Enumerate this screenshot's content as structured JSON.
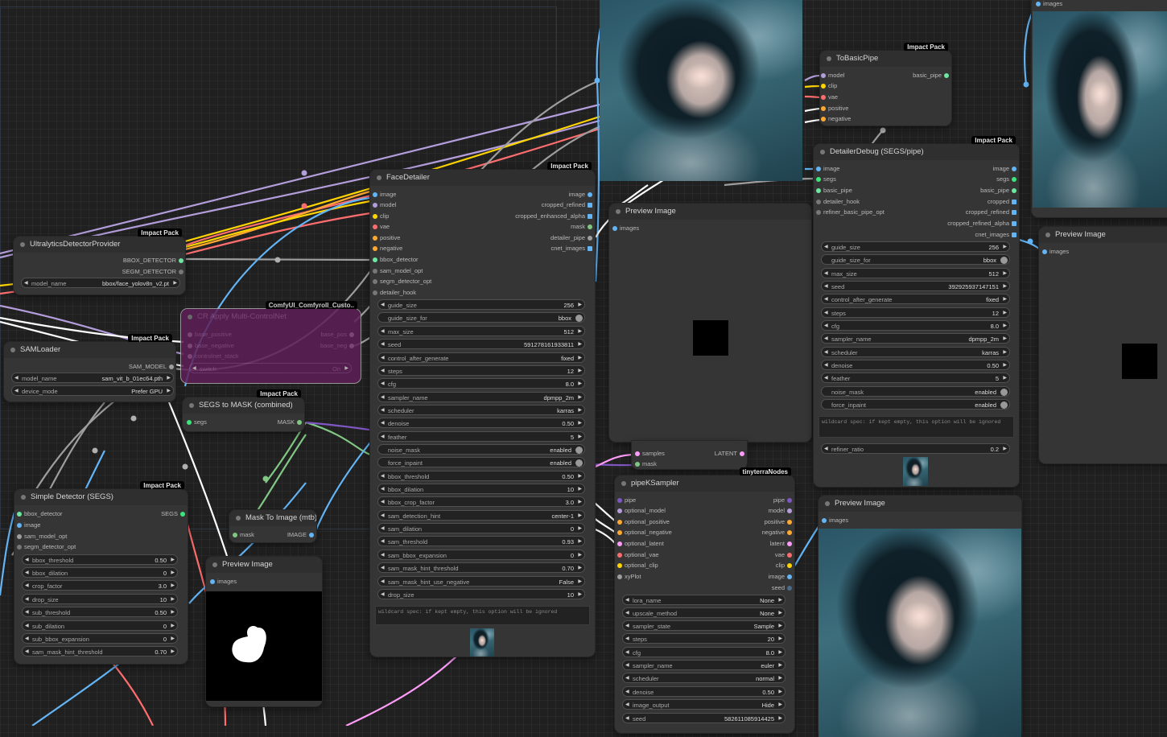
{
  "colors": {
    "canvas": "#202020",
    "node": "#353535",
    "model": "#b39ddb",
    "clip": "#ffd500",
    "vae": "#ff6e6e",
    "conditioning": "#ffa931",
    "image": "#64b5f6",
    "latent": "#ff9cf9",
    "pipe": "#7e57c2",
    "segs": "#3ce67b",
    "mask": "#81c784",
    "bbox": "#6ee7a0"
  },
  "ultralytics": {
    "badge": "Impact Pack",
    "title": "UltralyticsDetectorProvider",
    "out1": "BBOX_DETECTOR",
    "out2": "SEGM_DETECTOR",
    "w_label": "model_name",
    "w_value": "bbox/face_yolov8n_v2.pt"
  },
  "samloader": {
    "badge": "Impact Pack",
    "title": "SAMLoader",
    "out1": "SAM_MODEL",
    "w1_label": "model_name",
    "w1_value": "sam_vit_b_01ec64.pth",
    "w2_label": "device_mode",
    "w2_value": "Prefer GPU"
  },
  "cr_apply": {
    "badge": "ComfyUI_Comfyroll_Custo..",
    "title": "CR Apply Multi-ControlNet",
    "in1": "base_positive",
    "in2": "base_negative",
    "in3": "controlnet_stack",
    "out1": "base_pos",
    "out2": "base_neg",
    "w_label": "switch",
    "w_value": "On"
  },
  "segs_to_mask": {
    "badge": "Impact Pack",
    "title": "SEGS to MASK (combined)",
    "in1": "segs",
    "out1": "MASK"
  },
  "simple_detector": {
    "badge": "Impact Pack",
    "title": "Simple Detector (SEGS)",
    "in1": "bbox_detector",
    "in2": "image",
    "in3": "sam_model_opt",
    "in4": "segm_detector_opt",
    "out1": "SEGS",
    "widgets": [
      {
        "l": "bbox_threshold",
        "v": "0.50"
      },
      {
        "l": "bbox_dilation",
        "v": "0"
      },
      {
        "l": "crop_factor",
        "v": "3.0"
      },
      {
        "l": "drop_size",
        "v": "10"
      },
      {
        "l": "sub_threshold",
        "v": "0.50"
      },
      {
        "l": "sub_dilation",
        "v": "0"
      },
      {
        "l": "sub_bbox_expansion",
        "v": "0"
      },
      {
        "l": "sam_mask_hint_threshold",
        "v": "0.70"
      }
    ]
  },
  "mask_to_image": {
    "title": "Mask To Image (mtb)",
    "in1": "mask",
    "out1": "IMAGE"
  },
  "preview_mask": {
    "title": "Preview Image",
    "in1": "images"
  },
  "facedetailer": {
    "badge": "Impact Pack",
    "title": "FaceDetailer",
    "inputs": [
      "image",
      "model",
      "clip",
      "vae",
      "positive",
      "negative",
      "bbox_detector",
      "sam_model_opt",
      "segm_detector_opt",
      "detailer_hook"
    ],
    "outputs": [
      "image",
      "cropped_refined",
      "cropped_enhanced_alpha",
      "mask",
      "detailer_pipe",
      "cnet_images"
    ],
    "widgets": [
      {
        "l": "guide_size",
        "v": "256"
      },
      {
        "l": "guide_size_for",
        "v": "bbox"
      },
      {
        "l": "max_size",
        "v": "512"
      },
      {
        "l": "seed",
        "v": "591278161933811"
      },
      {
        "l": "control_after_generate",
        "v": "fixed"
      },
      {
        "l": "steps",
        "v": "12"
      },
      {
        "l": "cfg",
        "v": "8.0"
      },
      {
        "l": "sampler_name",
        "v": "dpmpp_2m"
      },
      {
        "l": "scheduler",
        "v": "karras"
      },
      {
        "l": "denoise",
        "v": "0.50"
      },
      {
        "l": "feather",
        "v": "5"
      },
      {
        "l": "noise_mask",
        "v": "enabled"
      },
      {
        "l": "force_inpaint",
        "v": "enabled"
      },
      {
        "l": "bbox_threshold",
        "v": "0.50"
      },
      {
        "l": "bbox_dilation",
        "v": "10"
      },
      {
        "l": "bbox_crop_factor",
        "v": "3.0"
      },
      {
        "l": "sam_detection_hint",
        "v": "center-1"
      },
      {
        "l": "sam_dilation",
        "v": "0"
      },
      {
        "l": "sam_threshold",
        "v": "0.93"
      },
      {
        "l": "sam_bbox_expansion",
        "v": "0"
      },
      {
        "l": "sam_mask_hint_threshold",
        "v": "0.70"
      },
      {
        "l": "sam_mask_hint_use_negative",
        "v": "False"
      },
      {
        "l": "drop_size",
        "v": "10"
      }
    ],
    "wildcard": "wildcard spec: if kept empty, this option will be ignored"
  },
  "preview_center": {
    "title": "Preview Image",
    "in1": "images"
  },
  "samples_node": {
    "in1": "samples",
    "in2": "mask",
    "out1": "LATENT"
  },
  "pipeksampler": {
    "badge": "tinyterraNodes",
    "title": "pipeKSampler",
    "inputs": [
      "pipe",
      "optional_model",
      "optional_positive",
      "optional_negative",
      "optional_latent",
      "optional_vae",
      "optional_clip",
      "xyPlot"
    ],
    "outputs": [
      "pipe",
      "model",
      "positive",
      "negative",
      "latent",
      "vae",
      "clip",
      "image",
      "seed"
    ],
    "widgets": [
      {
        "l": "lora_name",
        "v": "None"
      },
      {
        "l": "upscale_method",
        "v": "None"
      },
      {
        "l": "sampler_state",
        "v": "Sample"
      },
      {
        "l": "steps",
        "v": "20"
      },
      {
        "l": "cfg",
        "v": "8.0"
      },
      {
        "l": "sampler_name",
        "v": "euler"
      },
      {
        "l": "scheduler",
        "v": "normal"
      },
      {
        "l": "denoise",
        "v": "0.50"
      },
      {
        "l": "image_output",
        "v": "Hide"
      },
      {
        "l": "seed",
        "v": "582611085914425"
      }
    ]
  },
  "tobasicpipe": {
    "badge": "Impact Pack",
    "title": "ToBasicPipe",
    "inputs": [
      "model",
      "clip",
      "vae",
      "positive",
      "negative"
    ],
    "out1": "basic_pipe"
  },
  "detailerdebug": {
    "badge": "Impact Pack",
    "title": "DetailerDebug (SEGS/pipe)",
    "inputs": [
      "image",
      "segs",
      "basic_pipe",
      "detailer_hook",
      "refiner_basic_pipe_opt"
    ],
    "outputs": [
      "image",
      "segs",
      "basic_pipe",
      "cropped",
      "cropped_refined",
      "cropped_refined_alpha",
      "cnet_images"
    ],
    "widgets": [
      {
        "l": "guide_size",
        "v": "256"
      },
      {
        "l": "guide_size_for",
        "v": "bbox"
      },
      {
        "l": "max_size",
        "v": "512"
      },
      {
        "l": "seed",
        "v": "392925937147151"
      },
      {
        "l": "control_after_generate",
        "v": "fixed"
      },
      {
        "l": "steps",
        "v": "12"
      },
      {
        "l": "cfg",
        "v": "8.0"
      },
      {
        "l": "sampler_name",
        "v": "dpmpp_2m"
      },
      {
        "l": "scheduler",
        "v": "karras"
      },
      {
        "l": "denoise",
        "v": "0.50"
      },
      {
        "l": "feather",
        "v": "5"
      },
      {
        "l": "noise_mask",
        "v": "enabled"
      },
      {
        "l": "force_inpaint",
        "v": "enabled"
      }
    ],
    "wildcard": "wildcard spec: if kept empty, this option will be ignored",
    "refiner_label": "refiner_ratio",
    "refiner_value": "0.2"
  },
  "preview_right": {
    "title": "Preview Image",
    "in1": "images"
  },
  "preview_bottom": {
    "title": "Preview Image",
    "in1": "images"
  },
  "preview_topright": {
    "in1": "images"
  }
}
